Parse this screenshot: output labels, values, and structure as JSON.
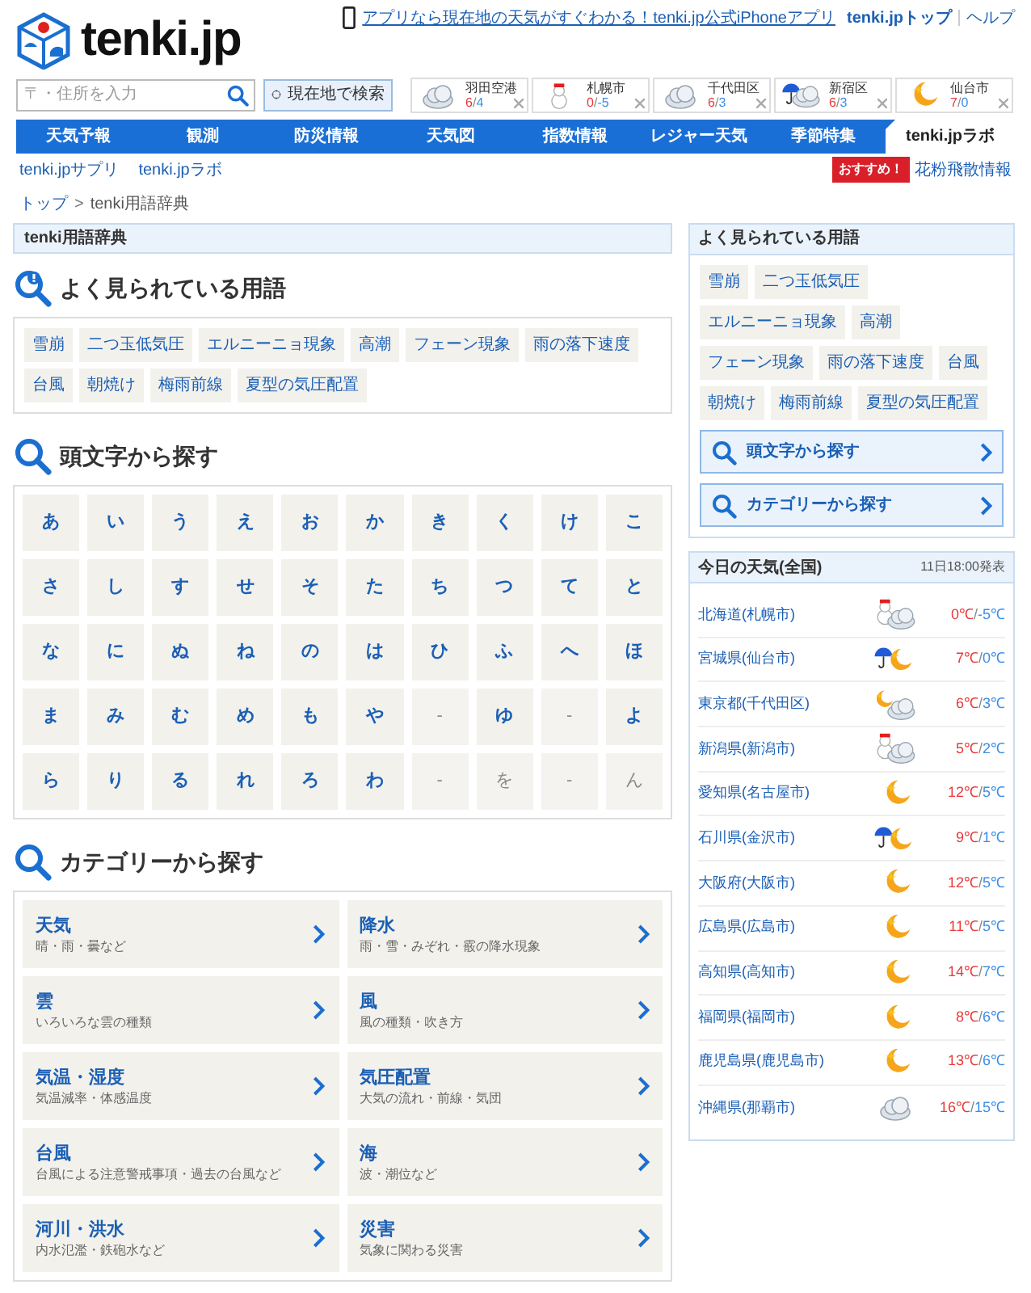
{
  "header": {
    "logo": "tenki.jp",
    "app_link": "アプリなら現在地の天気がすぐわかる！tenki.jp公式iPhoneアプリ",
    "top_link": "tenki.jpトップ",
    "help_link": "ヘルプ"
  },
  "search": {
    "placeholder": "〒・住所を入力",
    "locate_button": "現在地で検索"
  },
  "saved_places": [
    {
      "name": "羽田空港",
      "kind": "cloud",
      "high": "6",
      "separator": "/",
      "low": "4"
    },
    {
      "name": "札幌市",
      "kind": "snowman",
      "high": "0",
      "separator": "/",
      "low": "-5"
    },
    {
      "name": "千代田区",
      "kind": "cloud",
      "high": "6",
      "separator": "/",
      "low": "3"
    },
    {
      "name": "新宿区",
      "kind": "rain_cloud",
      "high": "6",
      "separator": "/",
      "low": "3"
    },
    {
      "name": "仙台市",
      "kind": "moon",
      "high": "7",
      "separator": "/",
      "low": "0"
    }
  ],
  "nav": [
    {
      "label": "天気予報",
      "selected": false
    },
    {
      "label": "観測",
      "selected": false
    },
    {
      "label": "防災情報",
      "selected": false
    },
    {
      "label": "天気図",
      "selected": false
    },
    {
      "label": "指数情報",
      "selected": false
    },
    {
      "label": "レジャー天気",
      "selected": false
    },
    {
      "label": "季節特集",
      "selected": false
    },
    {
      "label": "tenki.jpラボ",
      "selected": true
    }
  ],
  "sub_links": [
    "tenki.jpサプリ",
    "tenki.jpラボ"
  ],
  "promo": {
    "badge": "おすすめ！",
    "link": "花粉飛散情報"
  },
  "breadcrumb": {
    "items": [
      "トップ",
      "tenki用語辞典"
    ],
    "separator": ">"
  },
  "page_title": "tenki用語辞典",
  "popular": {
    "heading": "よく見られている用語",
    "terms": [
      "雪崩",
      "二つ玉低気圧",
      "エルニーニョ現象",
      "高潮",
      "フェーン現象",
      "雨の落下速度",
      "台風",
      "朝焼け",
      "梅雨前線",
      "夏型の気圧配置"
    ]
  },
  "kana": {
    "heading": "頭文字から探す",
    "rows": [
      [
        {
          "label": "あ",
          "disabled": false
        },
        {
          "label": "い",
          "disabled": false
        },
        {
          "label": "う",
          "disabled": false
        },
        {
          "label": "え",
          "disabled": false
        },
        {
          "label": "お",
          "disabled": false
        },
        {
          "label": "か",
          "disabled": false
        },
        {
          "label": "き",
          "disabled": false
        },
        {
          "label": "く",
          "disabled": false
        },
        {
          "label": "け",
          "disabled": false
        },
        {
          "label": "こ",
          "disabled": false
        }
      ],
      [
        {
          "label": "さ",
          "disabled": false
        },
        {
          "label": "し",
          "disabled": false
        },
        {
          "label": "す",
          "disabled": false
        },
        {
          "label": "せ",
          "disabled": false
        },
        {
          "label": "そ",
          "disabled": false
        },
        {
          "label": "た",
          "disabled": false
        },
        {
          "label": "ち",
          "disabled": false
        },
        {
          "label": "つ",
          "disabled": false
        },
        {
          "label": "て",
          "disabled": false
        },
        {
          "label": "と",
          "disabled": false
        }
      ],
      [
        {
          "label": "な",
          "disabled": false
        },
        {
          "label": "に",
          "disabled": false
        },
        {
          "label": "ぬ",
          "disabled": false
        },
        {
          "label": "ね",
          "disabled": false
        },
        {
          "label": "の",
          "disabled": false
        },
        {
          "label": "は",
          "disabled": false
        },
        {
          "label": "ひ",
          "disabled": false
        },
        {
          "label": "ふ",
          "disabled": false
        },
        {
          "label": "へ",
          "disabled": false
        },
        {
          "label": "ほ",
          "disabled": false
        }
      ],
      [
        {
          "label": "ま",
          "disabled": false
        },
        {
          "label": "み",
          "disabled": false
        },
        {
          "label": "む",
          "disabled": false
        },
        {
          "label": "め",
          "disabled": false
        },
        {
          "label": "も",
          "disabled": false
        },
        {
          "label": "や",
          "disabled": false
        },
        {
          "label": "-",
          "disabled": true
        },
        {
          "label": "ゆ",
          "disabled": false
        },
        {
          "label": "-",
          "disabled": true
        },
        {
          "label": "よ",
          "disabled": false
        }
      ],
      [
        {
          "label": "ら",
          "disabled": false
        },
        {
          "label": "り",
          "disabled": false
        },
        {
          "label": "る",
          "disabled": false
        },
        {
          "label": "れ",
          "disabled": false
        },
        {
          "label": "ろ",
          "disabled": false
        },
        {
          "label": "わ",
          "disabled": false
        },
        {
          "label": "-",
          "disabled": true
        },
        {
          "label": "を",
          "disabled": true
        },
        {
          "label": "-",
          "disabled": true
        },
        {
          "label": "ん",
          "disabled": true
        }
      ]
    ]
  },
  "categories": {
    "heading": "カテゴリーから探す",
    "items": [
      {
        "title": "天気",
        "description": "晴・雨・曇など"
      },
      {
        "title": "降水",
        "description": "雨・雪・みぞれ・霰の降水現象"
      },
      {
        "title": "雲",
        "description": "いろいろな雲の種類"
      },
      {
        "title": "風",
        "description": "風の種類・吹き方"
      },
      {
        "title": "気温・湿度",
        "description": "気温減率・体感温度"
      },
      {
        "title": "気圧配置",
        "description": "大気の流れ・前線・気団"
      },
      {
        "title": "台風",
        "description": "台風による注意警戒事項・過去の台風など"
      },
      {
        "title": "海",
        "description": "波・潮位など"
      },
      {
        "title": "河川・洪水",
        "description": "内水氾濫・鉄砲水など"
      },
      {
        "title": "災害",
        "description": "気象に関わる災害"
      }
    ]
  },
  "sidebar": {
    "popular": {
      "heading": "よく見られている用語",
      "terms": [
        "雪崩",
        "二つ玉低気圧",
        "エルニーニョ現象",
        "高潮",
        "フェーン現象",
        "雨の落下速度",
        "台風",
        "朝焼け",
        "梅雨前線",
        "夏型の気圧配置"
      ]
    },
    "links": [
      "頭文字から探す",
      "カテゴリーから探す"
    ],
    "weather": {
      "title": "今日の天気(全国)",
      "issued": "11日18:00発表",
      "rows": [
        {
          "area": "北海道(札幌市)",
          "kind": "snow_cloud",
          "high": "0℃",
          "separator": "/",
          "low": "-5℃"
        },
        {
          "area": "宮城県(仙台市)",
          "kind": "rain_moon",
          "high": "7℃",
          "separator": "/",
          "low": "0℃"
        },
        {
          "area": "東京都(千代田区)",
          "kind": "moon_cloud",
          "high": "6℃",
          "separator": "/",
          "low": "3℃"
        },
        {
          "area": "新潟県(新潟市)",
          "kind": "snow_cloud",
          "high": "5℃",
          "separator": "/",
          "low": "2℃"
        },
        {
          "area": "愛知県(名古屋市)",
          "kind": "moon",
          "high": "12℃",
          "separator": "/",
          "low": "5℃"
        },
        {
          "area": "石川県(金沢市)",
          "kind": "rain_moon",
          "high": "9℃",
          "separator": "/",
          "low": "1℃"
        },
        {
          "area": "大阪府(大阪市)",
          "kind": "moon",
          "high": "12℃",
          "separator": "/",
          "low": "5℃"
        },
        {
          "area": "広島県(広島市)",
          "kind": "moon",
          "high": "11℃",
          "separator": "/",
          "low": "5℃"
        },
        {
          "area": "高知県(高知市)",
          "kind": "moon",
          "high": "14℃",
          "separator": "/",
          "low": "7℃"
        },
        {
          "area": "福岡県(福岡市)",
          "kind": "moon",
          "high": "8℃",
          "separator": "/",
          "low": "6℃"
        },
        {
          "area": "鹿児島県(鹿児島市)",
          "kind": "moon",
          "high": "13℃",
          "separator": "/",
          "low": "6℃"
        },
        {
          "area": "沖縄県(那覇市)",
          "kind": "cloud",
          "high": "16℃",
          "separator": "/",
          "low": "15℃"
        }
      ]
    }
  }
}
